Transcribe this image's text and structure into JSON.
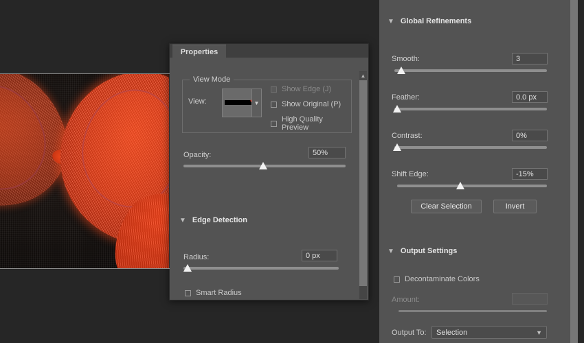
{
  "canvas": {
    "background_color": "#262626",
    "image_alt": "close-up of red embroidered knit heart on black fabric"
  },
  "properties_panel": {
    "tab_label": "Properties",
    "view_mode": {
      "group_title": "View Mode",
      "view_label": "View:",
      "view_thumbnail_name": "on-black-view-preview",
      "checkboxes": [
        {
          "label": "Show Edge (J)",
          "checked": false,
          "enabled": false
        },
        {
          "label": "Show Original (P)",
          "checked": false,
          "enabled": true
        },
        {
          "label": "High Quality Preview",
          "checked": false,
          "enabled": true
        }
      ]
    },
    "opacity": {
      "label": "Opacity:",
      "value": "50%",
      "slider_percent": 50
    },
    "edge_detection": {
      "header": "Edge Detection",
      "expanded": true,
      "radius": {
        "label": "Radius:",
        "value": "0 px",
        "slider_percent": 0
      },
      "smart_radius": {
        "label": "Smart Radius",
        "checked": false
      }
    },
    "scrollbar": {
      "up_arrow_icon": "chevron-up-icon"
    }
  },
  "right_dock": {
    "global_refinements": {
      "header": "Global Refinements",
      "expanded": true,
      "sliders": [
        {
          "label": "Smooth:",
          "value": "3",
          "slider_percent": 4
        },
        {
          "label": "Feather:",
          "value": "0.0 px",
          "slider_percent": 0
        },
        {
          "label": "Contrast:",
          "value": "0%",
          "slider_percent": 0
        },
        {
          "label": "Shift Edge:",
          "value": "-15%",
          "slider_percent": 42
        }
      ],
      "buttons": [
        {
          "label": "Clear Selection"
        },
        {
          "label": "Invert"
        }
      ]
    },
    "output_settings": {
      "header": "Output Settings",
      "expanded": true,
      "decontaminate": {
        "label": "Decontaminate Colors",
        "checked": false
      },
      "amount": {
        "label": "Amount:",
        "value": "",
        "enabled": false,
        "slider_percent": 0
      },
      "output_to": {
        "label": "Output To:",
        "value": "Selection",
        "arrow_icon": "chevron-down-icon"
      }
    }
  },
  "colors": {
    "panel_bg": "#535353",
    "canvas_bg": "#262626",
    "accent_red": "#e8301c",
    "text": "#d2d2d2"
  }
}
